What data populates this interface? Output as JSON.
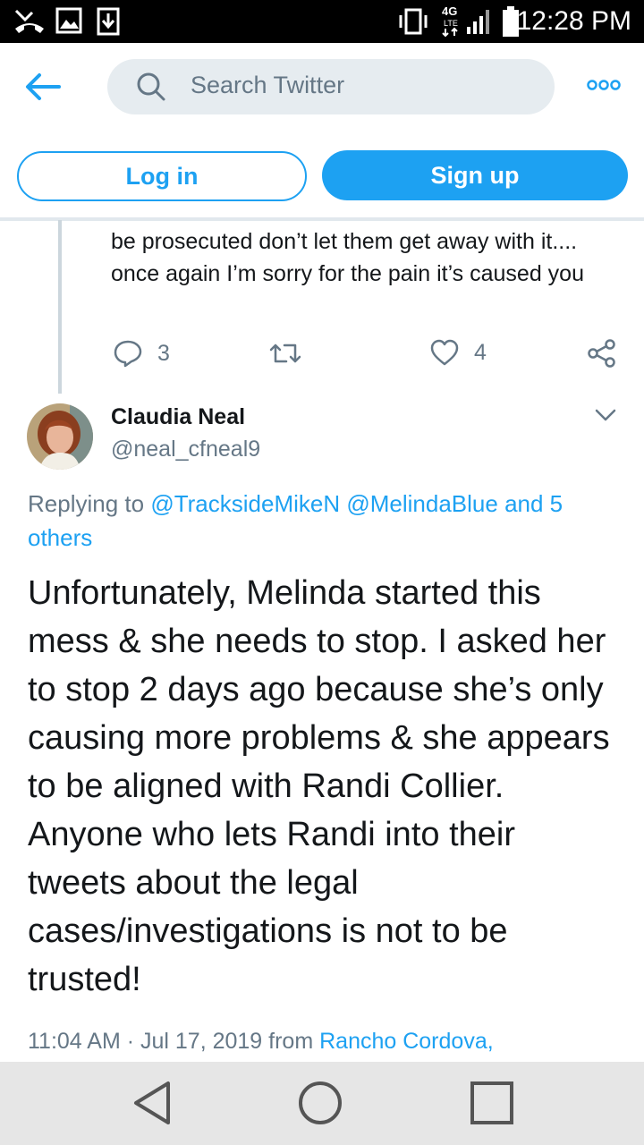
{
  "status_bar": {
    "time": "12:28 PM",
    "network": "4G LTE",
    "icons": [
      "missed-call-icon",
      "image-icon",
      "download-icon",
      "vibrate-icon",
      "signal-icon",
      "battery-icon"
    ]
  },
  "header": {
    "search_placeholder": "Search Twitter",
    "login_label": "Log in",
    "signup_label": "Sign up",
    "accent": "#1da1f2"
  },
  "previous_tweet": {
    "text": "be prosecuted don’t let them get away with it.... once again I’m sorry for the pain it’s caused you",
    "reply_count": "3",
    "like_count": "4"
  },
  "tweet": {
    "name": "Claudia Neal",
    "handle": "@neal_cfneal9",
    "replying_prefix": "Replying to",
    "reply_mention_1": "@TracksideMikeN",
    "reply_mention_2": "@MelindaBlue",
    "reply_others": "and 5 others",
    "text": "Unfortunately, Melinda started this mess & she needs to stop. I asked her to stop 2 days ago because she’s only causing more problems & she appears to be aligned with Randi Collier. Anyone who lets Randi into their tweets about the legal cases/investigations is not to be trusted!",
    "timestamp": "11:04 AM · Jul 17, 2019 from",
    "location": "Rancho Cordova,"
  },
  "nav_bar": {
    "buttons": [
      "back-triangle-icon",
      "home-circle-icon",
      "recents-square-icon"
    ]
  }
}
